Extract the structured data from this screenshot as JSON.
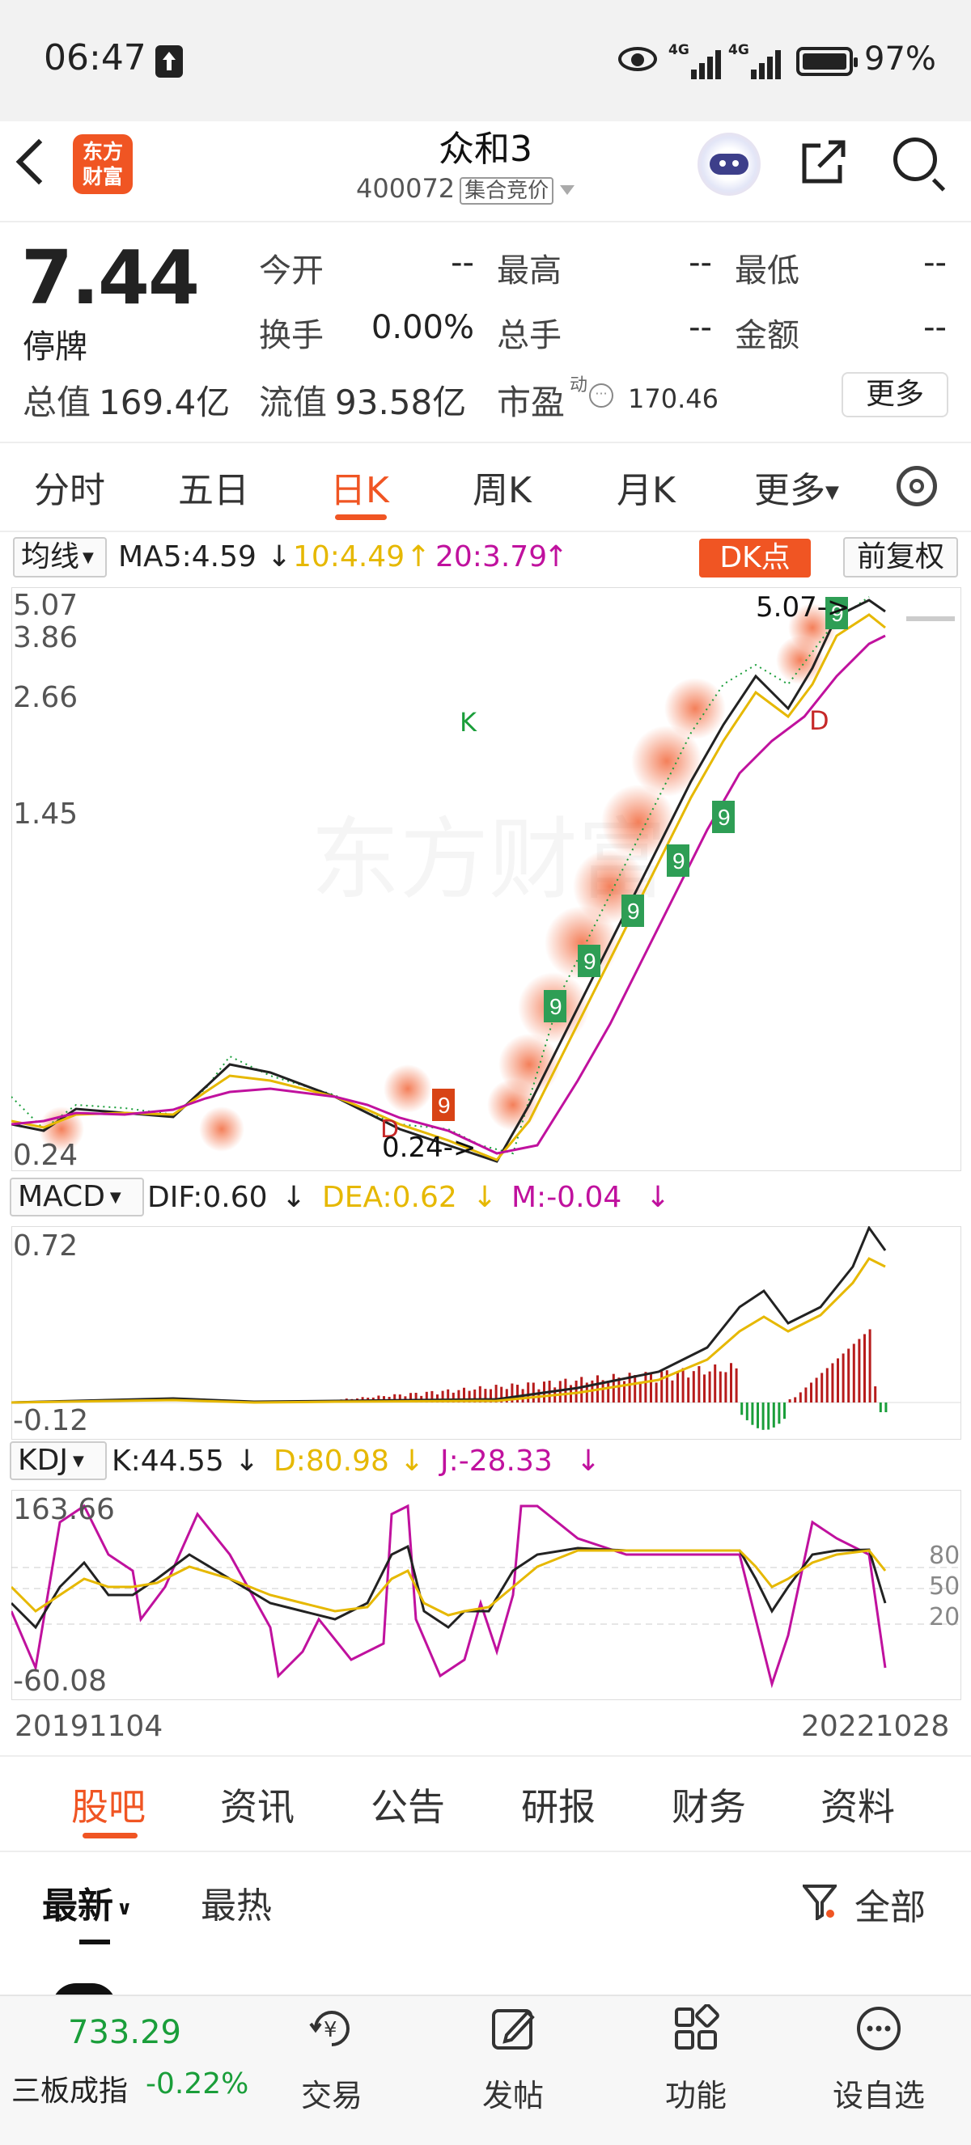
{
  "status_bar": {
    "time": "06:47",
    "signal1": "4G",
    "signal2": "4G",
    "battery": "97%"
  },
  "header": {
    "logo_text": "东方财富",
    "title": "众和3",
    "code": "400072",
    "auction_tag": "集合竞价"
  },
  "quote": {
    "price": "7.44",
    "status": "停牌",
    "open_label": "今开",
    "open_value": "--",
    "high_label": "最高",
    "high_value": "--",
    "low_label": "最低",
    "low_value": "--",
    "turnover_label": "换手",
    "turnover_value": "0.00%",
    "volume_label": "总手",
    "volume_value": "--",
    "amount_label": "金额",
    "amount_value": "--",
    "mktcap_label": "总值",
    "mktcap_value": "169.4亿",
    "float_label": "流值",
    "float_value": "93.58亿",
    "pe_label": "市盈",
    "pe_sup": "动",
    "pe_value": "170.46",
    "more_label": "更多"
  },
  "tabs": [
    {
      "label": "分时"
    },
    {
      "label": "五日"
    },
    {
      "label": "日K"
    },
    {
      "label": "周K"
    },
    {
      "label": "月K"
    },
    {
      "label": "更多"
    }
  ],
  "active_tab": "日K",
  "ma_bar": {
    "selector": "均线",
    "ma5": "MA5:4.59",
    "ma10": "10:4.49",
    "ma20": "20:3.79",
    "dk_label": "DK点",
    "adjust_label": "前复权"
  },
  "kline": {
    "y_labels": [
      "5.07",
      "3.86",
      "2.66",
      "1.45",
      "0.24"
    ],
    "high_annot": "5.07->",
    "low_annot": "0.24->",
    "watermark": "东方财富",
    "k_marker": "K",
    "d_marker": "D",
    "nine": "9"
  },
  "macd_bar": {
    "selector": "MACD",
    "dif": "DIF:0.60",
    "dea": "DEA:0.62",
    "m": "M:-0.04"
  },
  "macd": {
    "y_top": "0.72",
    "y_bottom": "-0.12"
  },
  "kdj_bar": {
    "selector": "KDJ",
    "k": "K:44.55",
    "d": "D:80.98",
    "j": "J:-28.33"
  },
  "kdj": {
    "y_top": "163.66",
    "y_bottom": "-60.08",
    "levels": [
      "80",
      "50",
      "20"
    ]
  },
  "dates": {
    "start": "20191104",
    "end": "20221028"
  },
  "bottom_tabs": [
    {
      "label": "股吧"
    },
    {
      "label": "资讯"
    },
    {
      "label": "公告"
    },
    {
      "label": "研报"
    },
    {
      "label": "财务"
    },
    {
      "label": "资料"
    }
  ],
  "feed": {
    "latest": "最新",
    "hot": "最热",
    "filter": "全部"
  },
  "nav": {
    "index_value": "733.29",
    "index_name": "三板成指",
    "index_change": "-0.22%",
    "trade": "交易",
    "post": "发帖",
    "functions": "功能",
    "watchlist": "设自选"
  },
  "colors": {
    "accent": "#f05523",
    "up": "#c62828",
    "down": "#1a9e3a",
    "ma10": "#e6b800",
    "ma20": "#c0119e"
  }
}
